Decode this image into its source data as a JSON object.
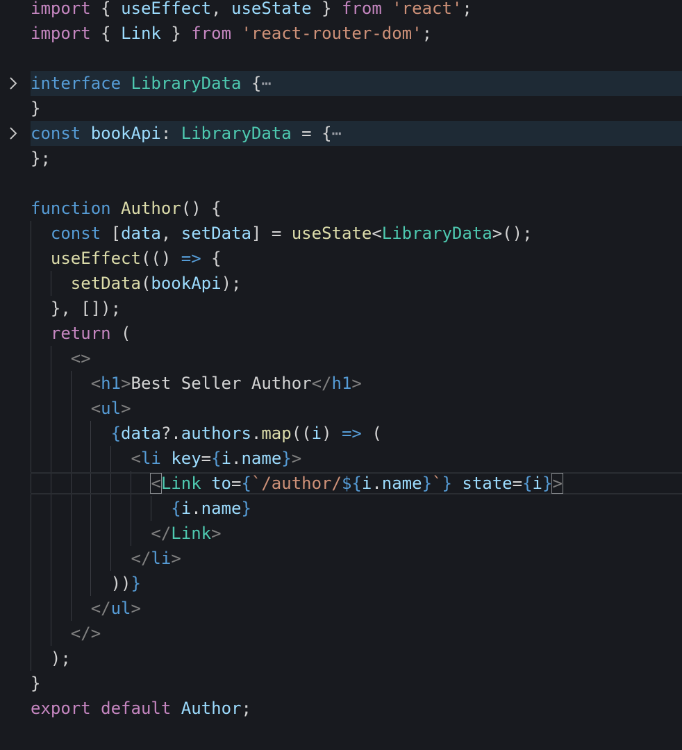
{
  "colors": {
    "background": "#181a1f",
    "keyword": "#c586c0",
    "storage": "#569cd6",
    "type": "#4ec9b0",
    "function": "#dcdcaa",
    "variable": "#9cdcfe",
    "string": "#ce9178",
    "tag": "#569cd6",
    "punctuation": "#d4d4d4",
    "tag_bracket": "#808080"
  },
  "folds": {
    "interface_chevron": "chevron-right-icon",
    "bookapi_chevron": "chevron-right-icon",
    "ellipsis": "⋯"
  },
  "code_lines": [
    [
      [
        "k",
        "import"
      ],
      [
        "p",
        " { "
      ],
      [
        "v",
        "useEffect"
      ],
      [
        "p",
        ", "
      ],
      [
        "v",
        "useState"
      ],
      [
        "p",
        " } "
      ],
      [
        "k",
        "from"
      ],
      [
        "p",
        " "
      ],
      [
        "s",
        "'react'"
      ],
      [
        "p",
        ";"
      ]
    ],
    [
      [
        "k",
        "import"
      ],
      [
        "p",
        " { "
      ],
      [
        "v",
        "Link"
      ],
      [
        "p",
        " } "
      ],
      [
        "k",
        "from"
      ],
      [
        "p",
        " "
      ],
      [
        "s",
        "'react-router-dom'"
      ],
      [
        "p",
        ";"
      ]
    ],
    [],
    [
      [
        "st",
        "interface"
      ],
      [
        "p",
        " "
      ],
      [
        "t",
        "LibraryData"
      ],
      [
        "p",
        " {"
      ],
      [
        "e",
        "⋯"
      ]
    ],
    [
      [
        "p",
        "}"
      ]
    ],
    [
      [
        "st",
        "const"
      ],
      [
        "p",
        " "
      ],
      [
        "v",
        "bookApi"
      ],
      [
        "p",
        ": "
      ],
      [
        "t",
        "LibraryData"
      ],
      [
        "p",
        " = {"
      ],
      [
        "e",
        "⋯"
      ]
    ],
    [
      [
        "p",
        "};"
      ]
    ],
    [],
    [
      [
        "st",
        "function"
      ],
      [
        "p",
        " "
      ],
      [
        "f",
        "Author"
      ],
      [
        "p",
        "() {"
      ]
    ],
    [
      [
        "p",
        "  "
      ],
      [
        "st",
        "const"
      ],
      [
        "p",
        " ["
      ],
      [
        "v",
        "data"
      ],
      [
        "p",
        ", "
      ],
      [
        "v",
        "setData"
      ],
      [
        "p",
        "] = "
      ],
      [
        "f",
        "useState"
      ],
      [
        "p",
        "<"
      ],
      [
        "t",
        "LibraryData"
      ],
      [
        "p",
        ">();"
      ]
    ],
    [
      [
        "p",
        "  "
      ],
      [
        "f",
        "useEffect"
      ],
      [
        "p",
        "(() "
      ],
      [
        "st",
        "=>"
      ],
      [
        "p",
        " {"
      ]
    ],
    [
      [
        "p",
        "    "
      ],
      [
        "f",
        "setData"
      ],
      [
        "p",
        "("
      ],
      [
        "v",
        "bookApi"
      ],
      [
        "p",
        ");"
      ]
    ],
    [
      [
        "p",
        "  }, []);"
      ]
    ],
    [
      [
        "p",
        "  "
      ],
      [
        "k",
        "return"
      ],
      [
        "p",
        " ("
      ]
    ],
    [
      [
        "p",
        "    "
      ],
      [
        "b",
        "<>"
      ]
    ],
    [
      [
        "p",
        "      "
      ],
      [
        "b",
        "<"
      ],
      [
        "g",
        "h1"
      ],
      [
        "b",
        ">"
      ],
      [
        "p",
        "Best Seller Author"
      ],
      [
        "b",
        "</"
      ],
      [
        "g",
        "h1"
      ],
      [
        "b",
        ">"
      ]
    ],
    [
      [
        "p",
        "      "
      ],
      [
        "b",
        "<"
      ],
      [
        "g",
        "ul"
      ],
      [
        "b",
        ">"
      ]
    ],
    [
      [
        "p",
        "        "
      ],
      [
        "st",
        "{"
      ],
      [
        "v",
        "data"
      ],
      [
        "p",
        "?."
      ],
      [
        "v",
        "authors"
      ],
      [
        "p",
        "."
      ],
      [
        "f",
        "map"
      ],
      [
        "p",
        "(("
      ],
      [
        "v",
        "i"
      ],
      [
        "p",
        ") "
      ],
      [
        "st",
        "=>"
      ],
      [
        "p",
        " ("
      ]
    ],
    [
      [
        "p",
        "          "
      ],
      [
        "b",
        "<"
      ],
      [
        "g",
        "li"
      ],
      [
        "p",
        " "
      ],
      [
        "v",
        "key"
      ],
      [
        "p",
        "="
      ],
      [
        "st",
        "{"
      ],
      [
        "v",
        "i"
      ],
      [
        "p",
        "."
      ],
      [
        "v",
        "name"
      ],
      [
        "st",
        "}"
      ],
      [
        "b",
        ">"
      ]
    ],
    [
      [
        "p",
        "            "
      ],
      [
        "bx",
        "<"
      ],
      [
        "t",
        "Link"
      ],
      [
        "p",
        " "
      ],
      [
        "v",
        "to"
      ],
      [
        "p",
        "="
      ],
      [
        "st",
        "{"
      ],
      [
        "s",
        "`/author/"
      ],
      [
        "st",
        "${"
      ],
      [
        "v",
        "i"
      ],
      [
        "p",
        "."
      ],
      [
        "v",
        "name"
      ],
      [
        "st",
        "}"
      ],
      [
        "s",
        "`"
      ],
      [
        "st",
        "}"
      ],
      [
        "p",
        " "
      ],
      [
        "v",
        "state"
      ],
      [
        "p",
        "="
      ],
      [
        "st",
        "{"
      ],
      [
        "v",
        "i"
      ],
      [
        "st",
        "}"
      ],
      [
        "bx",
        ">"
      ]
    ],
    [
      [
        "p",
        "              "
      ],
      [
        "st",
        "{"
      ],
      [
        "v",
        "i"
      ],
      [
        "p",
        "."
      ],
      [
        "v",
        "name"
      ],
      [
        "st",
        "}"
      ]
    ],
    [
      [
        "p",
        "            "
      ],
      [
        "b",
        "</"
      ],
      [
        "t",
        "Link"
      ],
      [
        "b",
        ">"
      ]
    ],
    [
      [
        "p",
        "          "
      ],
      [
        "b",
        "</"
      ],
      [
        "g",
        "li"
      ],
      [
        "b",
        ">"
      ]
    ],
    [
      [
        "p",
        "        ))"
      ],
      [
        "st",
        "}"
      ]
    ],
    [
      [
        "p",
        "      "
      ],
      [
        "b",
        "</"
      ],
      [
        "g",
        "ul"
      ],
      [
        "b",
        ">"
      ]
    ],
    [
      [
        "p",
        "    "
      ],
      [
        "b",
        "</>"
      ]
    ],
    [
      [
        "p",
        "  );"
      ]
    ],
    [
      [
        "p",
        "}"
      ]
    ],
    [
      [
        "k",
        "export"
      ],
      [
        "p",
        " "
      ],
      [
        "k",
        "default"
      ],
      [
        "p",
        " "
      ],
      [
        "v",
        "Author"
      ],
      [
        "p",
        ";"
      ]
    ]
  ]
}
